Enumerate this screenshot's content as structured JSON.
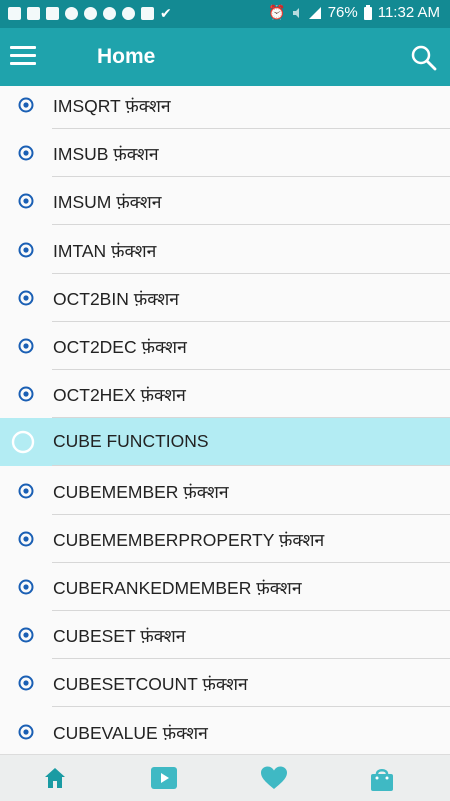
{
  "status_bar": {
    "battery": "76%",
    "time": "11:32 AM",
    "left_icons": [
      "flipboard-icon",
      "facebook-icon",
      "facebook-icon",
      "saturn-icon",
      "saturn-icon",
      "saturn-icon",
      "chrome-icon",
      "image-icon",
      "check-icon"
    ],
    "right_icons": [
      "alarm-icon",
      "mute-icon",
      "signal-icon",
      "battery-icon"
    ]
  },
  "app_bar": {
    "title": "Home",
    "menu_icon": "hamburger-menu-icon",
    "search_icon": "search-icon"
  },
  "list": {
    "items": [
      {
        "label": "IMSQRT फ़ंक्शन",
        "type": "bullet"
      },
      {
        "label": "IMSUB फ़ंक्शन",
        "type": "bullet"
      },
      {
        "label": "IMSUM फ़ंक्शन",
        "type": "bullet"
      },
      {
        "label": "IMTAN फ़ंक्शन",
        "type": "bullet"
      },
      {
        "label": "OCT2BIN फ़ंक्शन",
        "type": "bullet"
      },
      {
        "label": "OCT2DEC फ़ंक्शन",
        "type": "bullet"
      },
      {
        "label": "OCT2HEX फ़ंक्शन",
        "type": "bullet"
      },
      {
        "label": "CUBE FUNCTIONS",
        "type": "section"
      },
      {
        "label": "CUBEMEMBER फ़ंक्शन",
        "type": "bullet"
      },
      {
        "label": "CUBEMEMBERPROPERTY फ़ंक्शन",
        "type": "bullet"
      },
      {
        "label": "CUBERANKEDMEMBER फ़ंक्शन",
        "type": "bullet"
      },
      {
        "label": "CUBESET फ़ंक्शन",
        "type": "bullet"
      },
      {
        "label": "CUBESETCOUNT फ़ंक्शन",
        "type": "bullet"
      },
      {
        "label": "CUBEVALUE फ़ंक्शन",
        "type": "bullet"
      }
    ]
  },
  "bottom_nav": {
    "items": [
      {
        "icon": "home-icon"
      },
      {
        "icon": "video-play-icon"
      },
      {
        "icon": "heart-icon"
      },
      {
        "icon": "shopping-bag-icon"
      }
    ]
  },
  "colors": {
    "status_bar": "#138a93",
    "app_bar": "#1fa3ac",
    "bullet": "#1a5fb4",
    "highlight_row": "#b3ecf3",
    "bottom_icon": "#1a9ba3"
  }
}
